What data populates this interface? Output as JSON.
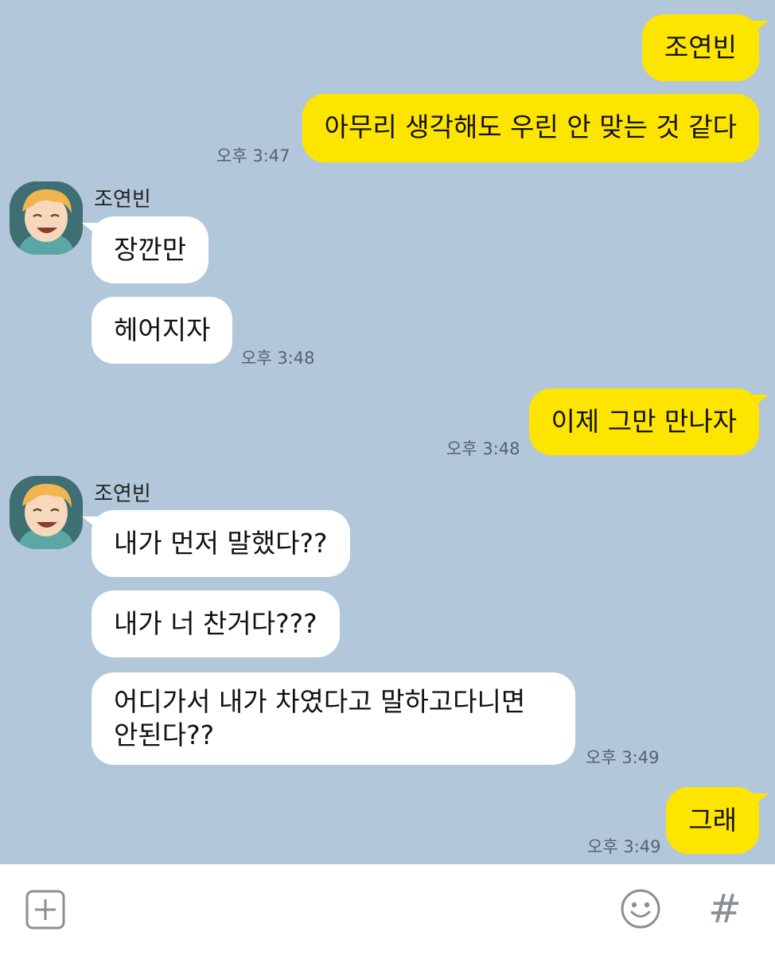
{
  "contact": {
    "name": "조연빈"
  },
  "messages": [
    {
      "from": "me",
      "text": "조연빈"
    },
    {
      "from": "me",
      "text": "아무리 생각해도 우린 안 맞는 것 같다",
      "time": "오후 3:47"
    },
    {
      "from": "them",
      "text": "장깐만"
    },
    {
      "from": "them",
      "text": "헤어지자",
      "time": "오후 3:48"
    },
    {
      "from": "me",
      "text": "이제 그만 만나자",
      "time": "오후 3:48"
    },
    {
      "from": "them",
      "text": "내가 먼저 말했다??"
    },
    {
      "from": "them",
      "text": "내가 너 찬거다???"
    },
    {
      "from": "them",
      "text": "어디가서 내가 차였다고 말하고다니면 안된다??",
      "time": "오후 3:49"
    },
    {
      "from": "me",
      "text": "그래",
      "time": "오후 3:49"
    }
  ],
  "input_bar": {
    "icons": [
      "add-icon",
      "emoji-icon",
      "hashtag-icon"
    ],
    "hashtag_glyph": "#"
  },
  "colors": {
    "background": "#b2c7da",
    "my_bubble": "#fee500",
    "their_bubble": "#ffffff"
  }
}
